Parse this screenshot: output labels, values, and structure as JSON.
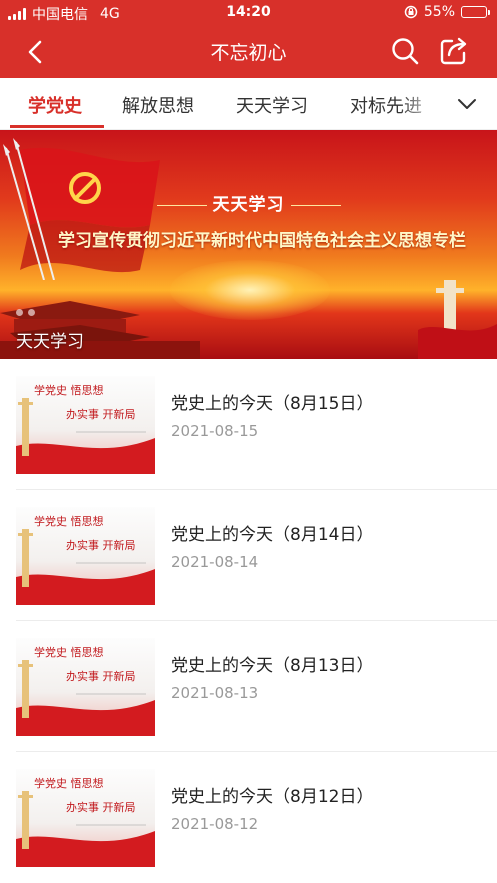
{
  "status_bar": {
    "carrier": "中国电信",
    "network": "4G",
    "time": "14:20",
    "battery": "55%",
    "battery_level": 0.55
  },
  "nav": {
    "title": "不忘初心",
    "back_icon": "chevron-left-icon",
    "search_icon": "search-icon",
    "share_icon": "share-icon"
  },
  "tabs": [
    {
      "label": "学党史",
      "active": true
    },
    {
      "label": "解放思想",
      "active": false
    },
    {
      "label": "天天学习",
      "active": false
    },
    {
      "label": "对标先进",
      "active": false
    }
  ],
  "banner": {
    "subtitle": "天天学习",
    "headline": "学习宣传贯彻习近平新时代中国特色社会主义思想专栏",
    "caption": "天天学习"
  },
  "articles": [
    {
      "title": "党史上的今天（8月15日）",
      "date": "2021-08-15"
    },
    {
      "title": "党史上的今天（8月14日）",
      "date": "2021-08-14"
    },
    {
      "title": "党史上的今天（8月13日）",
      "date": "2021-08-13"
    },
    {
      "title": "党史上的今天（8月12日）",
      "date": "2021-08-12"
    }
  ],
  "colors": {
    "accent": "#d8302a"
  }
}
